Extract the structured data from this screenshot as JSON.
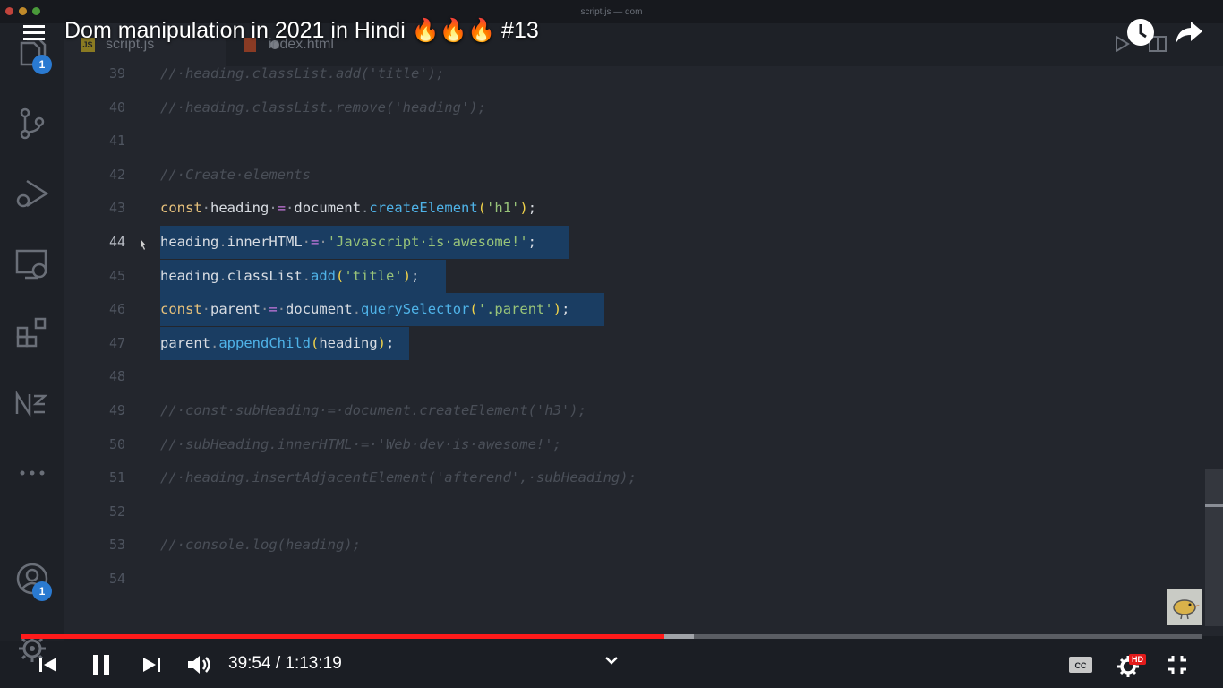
{
  "window": {
    "title": "script.js — dom"
  },
  "video": {
    "title": "Dom manipulation in 2021 in Hindi 🔥🔥🔥 #13"
  },
  "tabs": [
    {
      "label": "script.js",
      "badge": "JS"
    },
    {
      "label": "index.html"
    }
  ],
  "activity_bar": {
    "explorer_badge": "1",
    "account_badge": "1",
    "icons": [
      "files-icon",
      "source-control-icon",
      "run-debug-icon",
      "remote-explorer-icon",
      "extensions-icon",
      "n-logo-icon",
      "more-icon",
      "account-icon",
      "settings-gear-icon"
    ]
  },
  "editor": {
    "lines": [
      {
        "n": "39",
        "tokens": [
          [
            "c",
            "//·heading.classList.add('title');"
          ]
        ]
      },
      {
        "n": "40",
        "tokens": [
          [
            "c",
            "//·heading.classList.remove('heading');"
          ]
        ]
      },
      {
        "n": "41",
        "tokens": []
      },
      {
        "n": "42",
        "tokens": [
          [
            "c",
            "//·Create·elements"
          ]
        ]
      },
      {
        "n": "43",
        "tokens": [
          [
            "k",
            "const"
          ],
          [
            "d",
            "·"
          ],
          [
            "v",
            "heading"
          ],
          [
            "d",
            "·"
          ],
          [
            "o",
            "="
          ],
          [
            "d",
            "·"
          ],
          [
            "v",
            "document"
          ],
          [
            "d",
            "."
          ],
          [
            "f",
            "createElement"
          ],
          [
            "p",
            "("
          ],
          [
            "s",
            "'h1'"
          ],
          [
            "p",
            ")"
          ],
          [
            "v",
            ";"
          ]
        ]
      },
      {
        "n": "44",
        "current": true,
        "sel_to": 636,
        "tokens": [
          [
            "v",
            "heading"
          ],
          [
            "d",
            "."
          ],
          [
            "v",
            "innerHTML"
          ],
          [
            "d",
            "·"
          ],
          [
            "o",
            "="
          ],
          [
            "d",
            "·"
          ],
          [
            "s",
            "'Javascript·is·awesome!'"
          ],
          [
            "v",
            ";"
          ]
        ]
      },
      {
        "n": "45",
        "sel_to": 498,
        "tokens": [
          [
            "v",
            "heading"
          ],
          [
            "d",
            "."
          ],
          [
            "v",
            "classList"
          ],
          [
            "d",
            "."
          ],
          [
            "f",
            "add"
          ],
          [
            "p",
            "("
          ],
          [
            "s",
            "'title'"
          ],
          [
            "p",
            ")"
          ],
          [
            "v",
            ";"
          ]
        ]
      },
      {
        "n": "46",
        "sel_to": 675,
        "tokens": [
          [
            "k",
            "const"
          ],
          [
            "d",
            "·"
          ],
          [
            "v",
            "parent"
          ],
          [
            "d",
            "·"
          ],
          [
            "o",
            "="
          ],
          [
            "d",
            "·"
          ],
          [
            "v",
            "document"
          ],
          [
            "d",
            "."
          ],
          [
            "f",
            "querySelector"
          ],
          [
            "p",
            "("
          ],
          [
            "s",
            "'.parent'"
          ],
          [
            "p",
            ")"
          ],
          [
            "v",
            ";"
          ]
        ]
      },
      {
        "n": "47",
        "sel_to": 457,
        "tokens": [
          [
            "v",
            "parent"
          ],
          [
            "d",
            "."
          ],
          [
            "f",
            "appendChild"
          ],
          [
            "p",
            "("
          ],
          [
            "v",
            "heading"
          ],
          [
            "p",
            ")"
          ],
          [
            "v",
            ";"
          ]
        ]
      },
      {
        "n": "48",
        "tokens": []
      },
      {
        "n": "49",
        "tokens": [
          [
            "c",
            "//·const·subHeading·=·document.createElement('h3');"
          ]
        ]
      },
      {
        "n": "50",
        "tokens": [
          [
            "c",
            "//·subHeading.innerHTML·=·'Web·dev·is·awesome!';"
          ]
        ]
      },
      {
        "n": "51",
        "tokens": [
          [
            "c",
            "//·heading.insertAdjacentElement('afterend',·subHeading);"
          ]
        ]
      },
      {
        "n": "52",
        "tokens": []
      },
      {
        "n": "53",
        "tokens": [
          [
            "c",
            "//·console.log(heading);"
          ]
        ]
      },
      {
        "n": "54",
        "tokens": []
      }
    ]
  },
  "player": {
    "time_display": "39:54 / 1:13:19",
    "progress_fraction": 0.545,
    "buffered_fraction": 0.57,
    "hd_badge": "HD",
    "cc_label": "CC",
    "icons": [
      "skip-previous-icon",
      "pause-icon",
      "skip-next-icon",
      "volume-icon",
      "chevron-down-icon",
      "captions-icon",
      "settings-icon",
      "exit-fullscreen-icon",
      "watch-later-icon",
      "share-icon"
    ]
  },
  "colors": {
    "progress": "#ff1a1a",
    "selection": "#1a3d62",
    "badge": "#2a7ad1"
  }
}
